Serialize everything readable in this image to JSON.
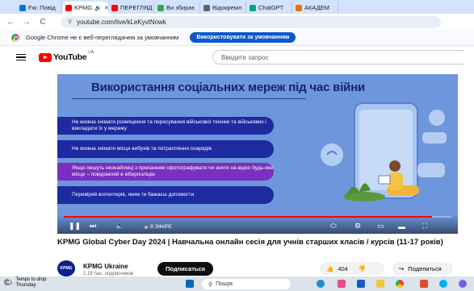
{
  "tabs": [
    {
      "label": "Fw: Повід",
      "active": false,
      "color": "#0078d4"
    },
    {
      "label": "KPMG",
      "active": true,
      "color": "#ff0000"
    },
    {
      "label": "ПЕРЕГЛЯД",
      "active": false,
      "color": "#ff0000"
    },
    {
      "label": "Ви збирає",
      "active": false,
      "color": "#34a853"
    },
    {
      "label": "Відокремл",
      "active": false,
      "color": "#5f6368"
    },
    {
      "label": "ChatGPT",
      "active": false,
      "color": "#10a37f"
    },
    {
      "label": "АКАДЕМ",
      "active": false,
      "color": "#e8710a"
    }
  ],
  "nav": {
    "back": "←",
    "forward": "→",
    "reload": "C"
  },
  "address": "youtube.com/live/kLeKyvtNowk",
  "infobar": {
    "message": "Google Chrome не є веб-переглядачем за умовчанням",
    "button": "Використовувати за умовчанням"
  },
  "youtube": {
    "brand": "YouTube",
    "country": "UA",
    "search_placeholder": "Введите запрос"
  },
  "video": {
    "slide_title": "Використання соціальних мереж під час війни",
    "points": [
      "Не можна знімати розміщення та пересування військової техніки та військових і викладати їх у мережу",
      "Не можна знімати місця вибухів та потрапляння снарядів",
      "Якщо пишуть незнайомці з проханням сфотографувати чи зняти на відео будь-яке місце – повідомляй в кіберполіцію",
      "Перевіряй волонтерів, яким ти бажаєш допомогти"
    ],
    "live_label": "В ЭФИРЕ",
    "progress": 0.95
  },
  "title": "KPMG Global Cyber Day 2024 | Навчальна онлайн сесія для учнів старших класів / курсів (11-17 років)",
  "channel": {
    "avatar": "KPMG",
    "name": "KPMG Ukraine",
    "subs": "2,19 тыс. подписчиков",
    "subscribe": "Подписаться",
    "likes": "404",
    "share": "Поделиться"
  },
  "taskbar": {
    "weather_title": "Temps to drop",
    "weather_sub": "Thursday",
    "search": "Пошук"
  }
}
